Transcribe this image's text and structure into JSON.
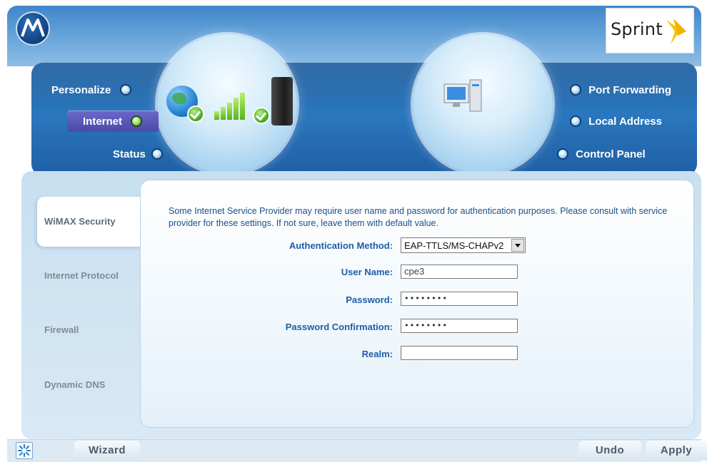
{
  "brand": {
    "left_logo": "motorola-logo",
    "right_logo_text": "Sprint"
  },
  "nav_left": {
    "items": [
      {
        "label": "Personalize",
        "active": false
      },
      {
        "label": "Internet",
        "active": true
      },
      {
        "label": "Status",
        "active": false
      }
    ]
  },
  "nav_right": {
    "items": [
      {
        "label": "Port Forwarding"
      },
      {
        "label": "Local Address"
      },
      {
        "label": "Control Panel"
      }
    ]
  },
  "sidebar": {
    "tabs": [
      {
        "label": "WiMAX Security",
        "active": true
      },
      {
        "label": "Internet Protocol",
        "active": false
      },
      {
        "label": "Firewall",
        "active": false
      },
      {
        "label": "Dynamic DNS",
        "active": false
      }
    ]
  },
  "form": {
    "description": "Some Internet Service Provider may require user name and password for authentication purposes. Please consult with service provider for these settings. If not sure, leave them with default value.",
    "auth_method": {
      "label": "Authentication Method:",
      "value": "EAP-TTLS/MS-CHAPv2"
    },
    "username": {
      "label": "User Name:",
      "value": "cpe3"
    },
    "password": {
      "label": "Password:",
      "value": "••••••••"
    },
    "password_confirm": {
      "label": "Password Confirmation:",
      "value": "••••••••"
    },
    "realm": {
      "label": "Realm:",
      "value": ""
    }
  },
  "bottom": {
    "wizard_label": "Wizard",
    "undo_label": "Undo",
    "apply_label": "Apply"
  },
  "colors": {
    "accent_blue": "#1d5ea8",
    "band_blue": "#2b77bd",
    "active_green": "#4a9a1d",
    "sprint_yellow": "#f7c600"
  }
}
